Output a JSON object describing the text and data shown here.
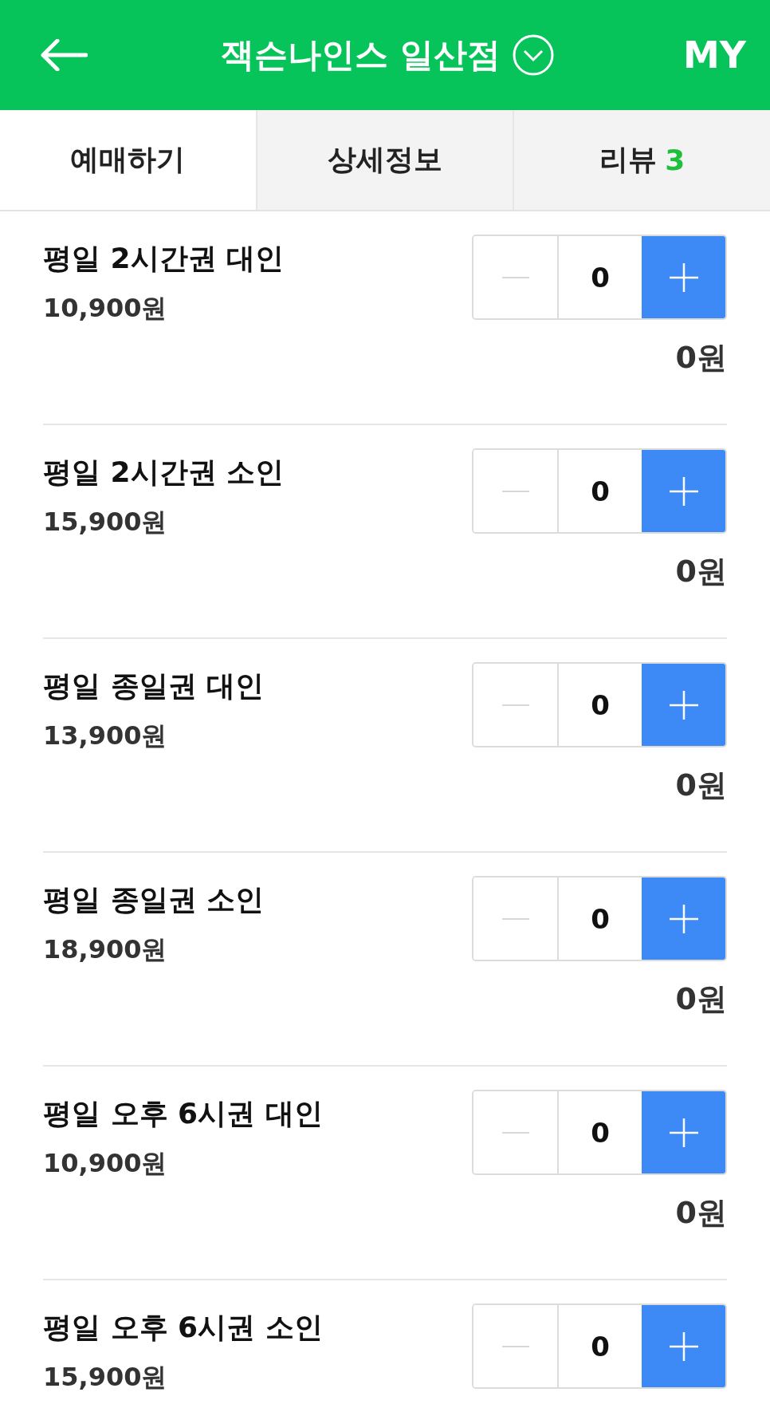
{
  "header": {
    "title": "잭슨나인스 일산점",
    "my": "MY"
  },
  "tabs": [
    {
      "label": "예매하기",
      "selected": true
    },
    {
      "label": "상세정보",
      "selected": false
    },
    {
      "label": "리뷰",
      "badge": "3",
      "selected": false
    }
  ],
  "tickets": [
    {
      "name": "평일 2시간권 대인",
      "price": "10,900원",
      "quantity": "0",
      "minus_disabled": true,
      "total": "0원"
    },
    {
      "name": "평일 2시간권 소인",
      "price": "15,900원",
      "quantity": "0",
      "minus_disabled": true,
      "total": "0원"
    },
    {
      "name": "평일 종일권 대인",
      "price": "13,900원",
      "quantity": "0",
      "minus_disabled": true,
      "total": "0원"
    },
    {
      "name": "평일 종일권 소인",
      "price": "18,900원",
      "quantity": "0",
      "minus_disabled": true,
      "total": "0원"
    },
    {
      "name": "평일 오후 6시권 대인",
      "price": "10,900원",
      "quantity": "0",
      "minus_disabled": true,
      "total": "0원"
    },
    {
      "name": "평일 오후 6시권 소인",
      "price": "15,900원",
      "quantity": "0",
      "minus_disabled": true
    }
  ]
}
